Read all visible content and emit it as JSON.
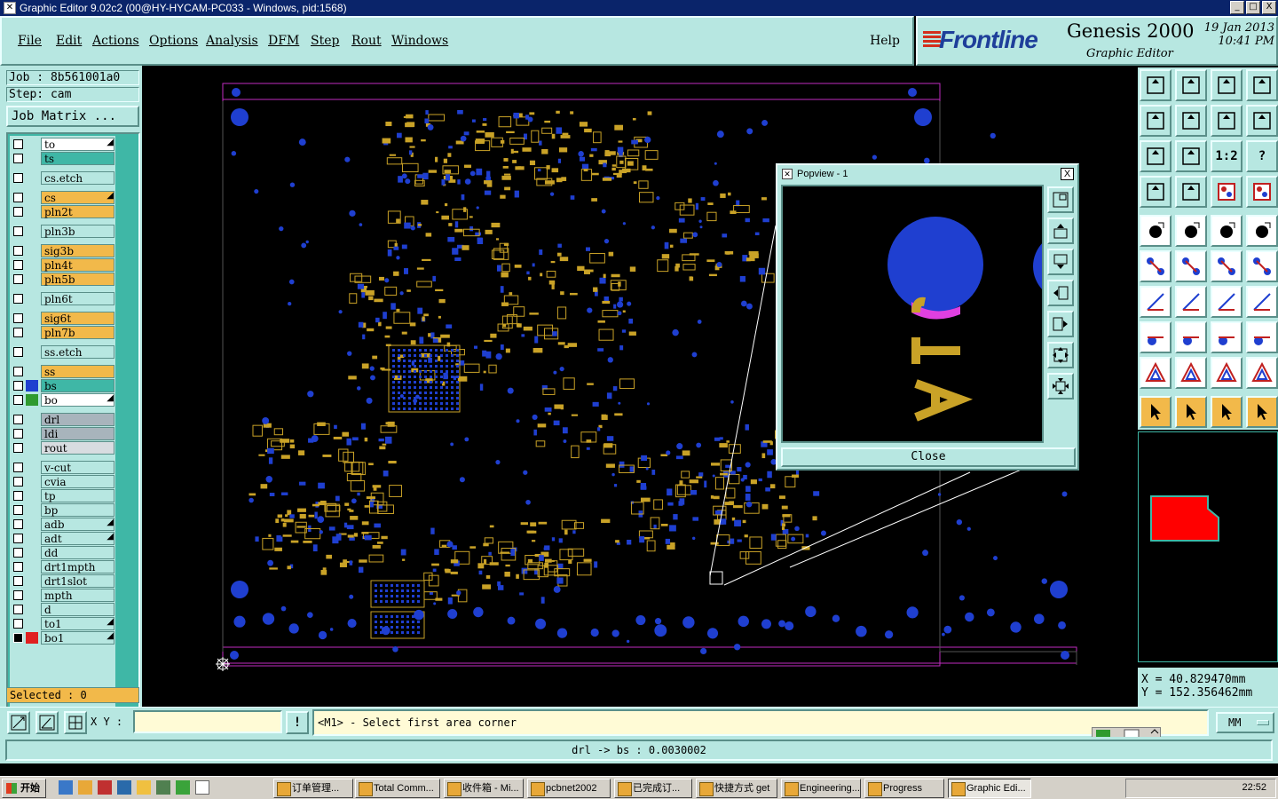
{
  "window": {
    "title": "Graphic Editor 9.02c2 (00@HY-HYCAM-PC033 - Windows, pid:1568)",
    "controls": [
      "_",
      "□",
      "X"
    ]
  },
  "menu": {
    "items": [
      {
        "label": "File"
      },
      {
        "label": "Edit"
      },
      {
        "label": "Actions"
      },
      {
        "label": "Options"
      },
      {
        "label": "Analysis"
      },
      {
        "label": "DFM"
      },
      {
        "label": "Step"
      },
      {
        "label": "Rout"
      },
      {
        "label": "Windows"
      }
    ],
    "help": "Help"
  },
  "brand": {
    "logo": "Frontline",
    "product": "Genesis 2000",
    "subtitle": "Graphic Editor",
    "date": "19 Jan 2013",
    "time": "10:41 PM"
  },
  "job": {
    "job_label": "Job : 8b561001a0",
    "step_label": "Step: cam",
    "matrix_button": "Job Matrix ..."
  },
  "layers": [
    {
      "name": "to",
      "bg": "#ffffff",
      "swatch": "",
      "arrow": true
    },
    {
      "name": "ts",
      "bg": "#3fb7a6",
      "swatch": "",
      "arrow": false
    },
    {
      "name": "cs.etch",
      "bg": "#b7e7e1",
      "swatch": "",
      "arrow": false
    },
    {
      "name": "cs",
      "bg": "#f2b94a",
      "swatch": "",
      "arrow": true
    },
    {
      "name": "pln2t",
      "bg": "#f2b94a",
      "swatch": "",
      "arrow": false
    },
    {
      "name": "pln3b",
      "bg": "#b7e7e1",
      "swatch": "",
      "arrow": false
    },
    {
      "name": "sig3b",
      "bg": "#f2b94a",
      "swatch": "",
      "arrow": false
    },
    {
      "name": "pln4t",
      "bg": "#f2b94a",
      "swatch": "",
      "arrow": false
    },
    {
      "name": "pln5b",
      "bg": "#f2b94a",
      "swatch": "",
      "arrow": false
    },
    {
      "name": "pln6t",
      "bg": "#b7e7e1",
      "swatch": "",
      "arrow": false
    },
    {
      "name": "sig6t",
      "bg": "#f2b94a",
      "swatch": "",
      "arrow": false
    },
    {
      "name": "pln7b",
      "bg": "#f2b94a",
      "swatch": "",
      "arrow": false
    },
    {
      "name": "ss.etch",
      "bg": "#b7e7e1",
      "swatch": "",
      "arrow": false
    },
    {
      "name": "ss",
      "bg": "#f2b94a",
      "swatch": "",
      "arrow": false
    },
    {
      "name": "bs",
      "bg": "#3fb7a6",
      "swatch": "#1f3fd0",
      "arrow": false
    },
    {
      "name": "bo",
      "bg": "#ffffff",
      "swatch": "#2f9a2f",
      "arrow": true
    },
    {
      "name": "drl",
      "bg": "#a8b4bc",
      "swatch": "",
      "arrow": false
    },
    {
      "name": "ldi",
      "bg": "#a8b4bc",
      "swatch": "",
      "arrow": false
    },
    {
      "name": "rout",
      "bg": "#d8dce0",
      "swatch": "",
      "arrow": false
    },
    {
      "name": "v-cut",
      "bg": "#b7e7e1",
      "swatch": "",
      "arrow": false
    },
    {
      "name": "cvia",
      "bg": "#b7e7e1",
      "swatch": "",
      "arrow": false
    },
    {
      "name": "tp",
      "bg": "#b7e7e1",
      "swatch": "",
      "arrow": false
    },
    {
      "name": "bp",
      "bg": "#b7e7e1",
      "swatch": "",
      "arrow": false
    },
    {
      "name": "adb",
      "bg": "#b7e7e1",
      "swatch": "",
      "arrow": true
    },
    {
      "name": "adt",
      "bg": "#b7e7e1",
      "swatch": "",
      "arrow": true
    },
    {
      "name": "dd",
      "bg": "#b7e7e1",
      "swatch": "",
      "arrow": false
    },
    {
      "name": "drt1mpth",
      "bg": "#b7e7e1",
      "swatch": "",
      "arrow": false
    },
    {
      "name": "drt1slot",
      "bg": "#b7e7e1",
      "swatch": "",
      "arrow": false
    },
    {
      "name": "mpth",
      "bg": "#b7e7e1",
      "swatch": "",
      "arrow": false
    },
    {
      "name": "d",
      "bg": "#b7e7e1",
      "swatch": "",
      "arrow": false
    },
    {
      "name": "to1",
      "bg": "#b7e7e1",
      "swatch": "",
      "arrow": true
    },
    {
      "name": "bo1",
      "bg": "#b7e7e1",
      "swatch": "#e02020",
      "arrow": true
    }
  ],
  "selected": "Selected : 0",
  "popview": {
    "title": "Popview - 1",
    "close_button": "Close",
    "close_x": "X"
  },
  "tools": {
    "ratio_label": "1:2",
    "help_label": "?"
  },
  "coords": {
    "x": "X = 40.829470mm",
    "y": "Y = 152.356462mm"
  },
  "command": {
    "xy_label": "X Y :",
    "xy_value": "",
    "info_label": "!",
    "prompt": "<M1> - Select first area corner",
    "units": "MM"
  },
  "status": "drl -> bs : 0.0030002",
  "taskbar": {
    "start": "开始",
    "tasks": [
      {
        "label": "订单管理..."
      },
      {
        "label": "Total Comm..."
      },
      {
        "label": "收件箱 - Mi..."
      },
      {
        "label": "pcbnet2002"
      },
      {
        "label": "已完成订..."
      },
      {
        "label": "快捷方式 get"
      },
      {
        "label": "Engineering..."
      },
      {
        "label": "Progress"
      },
      {
        "label": "Graphic Edi..."
      }
    ],
    "clock": "22:52"
  },
  "colors": {
    "panel": "#b7e7e1",
    "pad_blue": "#1f3fd0",
    "copper_yellow": "#c9a227",
    "outline_magenta": "#c02cc0"
  }
}
